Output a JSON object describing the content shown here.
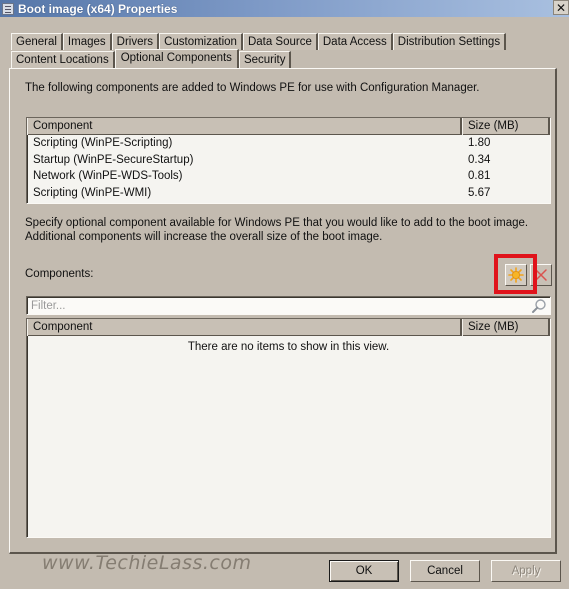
{
  "window": {
    "title": "Boot image (x64) Properties",
    "close_label": "✕"
  },
  "tabs": {
    "row1": [
      "General",
      "Images",
      "Drivers",
      "Customization",
      "Data Source",
      "Data Access",
      "Distribution Settings"
    ],
    "row2": [
      "Content Locations",
      "Optional Components",
      "Security"
    ],
    "active": "Optional Components"
  },
  "intro_text": "The following components are added to Windows PE for use with Configuration Manager.",
  "added_components": {
    "columns": [
      "Component",
      "Size (MB)"
    ],
    "rows": [
      {
        "component": "Scripting (WinPE-Scripting)",
        "size": "1.80"
      },
      {
        "component": "Startup (WinPE-SecureStartup)",
        "size": "0.34"
      },
      {
        "component": "Network (WinPE-WDS-Tools)",
        "size": "0.81"
      },
      {
        "component": "Scripting (WinPE-WMI)",
        "size": "5.67"
      }
    ]
  },
  "description": "Specify optional component available for Windows PE that you would like to add to the boot image. Additional components will increase the overall size of the boot image.",
  "components_section": {
    "label": "Components:",
    "add_icon": "starburst-add-icon",
    "remove_icon": "red-x-icon",
    "filter_placeholder": "Filter...",
    "filter_value": "",
    "columns": [
      "Component",
      "Size (MB)"
    ],
    "empty_message": "There are no items to show in this view."
  },
  "watermark": "www.TechieLass.com",
  "buttons": {
    "ok": "OK",
    "cancel": "Cancel",
    "apply": "Apply"
  },
  "colors": {
    "highlight": "#e0131b",
    "add_icon": "#f2a31a",
    "remove_icon": "#d9534f"
  }
}
